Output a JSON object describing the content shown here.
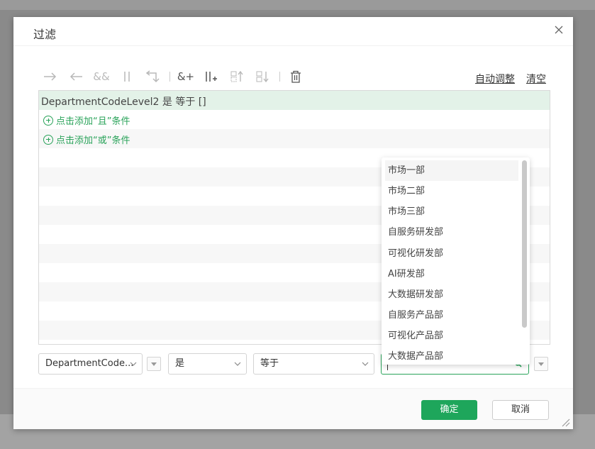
{
  "dialog": {
    "title": "过滤",
    "close_icon": "close-icon"
  },
  "toolbar": {
    "buttons": [
      {
        "name": "indent-right-arrow-icon",
        "label": "→"
      },
      {
        "name": "indent-left-arrow-icon",
        "label": "←"
      },
      {
        "name": "and-icon",
        "label": "&&"
      },
      {
        "name": "or-icon",
        "label": "||"
      },
      {
        "name": "return-icon",
        "label": "⮌"
      },
      {
        "name": "add-and-icon",
        "label": "&+"
      },
      {
        "name": "add-or-icon",
        "label": "||+"
      },
      {
        "name": "move-up-icon",
        "label": "↑"
      },
      {
        "name": "move-down-icon",
        "label": "↓"
      },
      {
        "name": "delete-icon",
        "label": "🗑"
      }
    ],
    "auto_adjust": "自动调整",
    "clear": "清空"
  },
  "conditions": {
    "expression": "DepartmentCodeLevel2 是 等于 []",
    "add_and": "点击添加“且”条件",
    "add_or": "点击添加“或”条件"
  },
  "editor": {
    "field_value": "DepartmentCode...",
    "is_value": "是",
    "operator_value": "等于",
    "search_value": ""
  },
  "dropdown": {
    "options": [
      "市场一部",
      "市场二部",
      "市场三部",
      "自服务研发部",
      "可视化研发部",
      "AI研发部",
      "大数据研发部",
      "自服务产品部",
      "可视化产品部",
      "大数据产品部"
    ]
  },
  "footer": {
    "ok_label": "确定",
    "cancel_label": "取消"
  },
  "colors": {
    "accent": "#1ea65b",
    "selected_row": "#e3f2e8"
  }
}
